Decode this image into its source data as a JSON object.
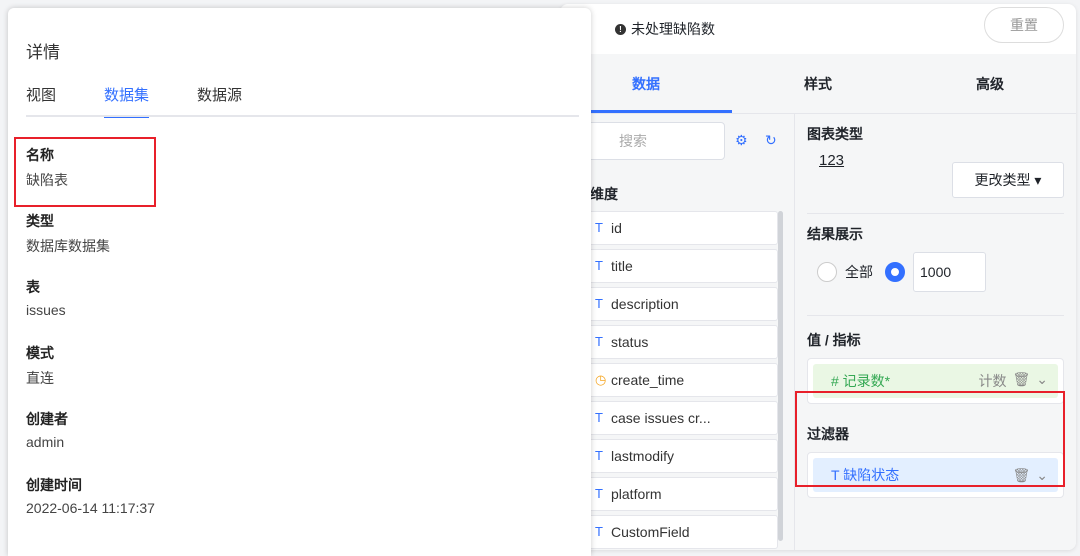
{
  "editor": {
    "chart_title": "未处理缺陷数",
    "reset": "重置",
    "tabs": [
      "数据",
      "样式",
      "高级"
    ],
    "search_placeholder": "搜索",
    "dimension_label": "维度",
    "fields": [
      {
        "type": "T",
        "name": "id"
      },
      {
        "type": "T",
        "name": "title"
      },
      {
        "type": "T",
        "name": "description"
      },
      {
        "type": "T",
        "name": "status"
      },
      {
        "type": "time",
        "name": "create_time"
      },
      {
        "type": "T",
        "name": "case issues cr..."
      },
      {
        "type": "T",
        "name": "lastmodify"
      },
      {
        "type": "T",
        "name": "platform"
      },
      {
        "type": "T",
        "name": "CustomField"
      }
    ],
    "chart_type_label": "图表类型",
    "chart_type_value": "123",
    "change_type": "更改类型 ▾",
    "result_label": "结果展示",
    "radio_all": "全部",
    "result_count": "1000",
    "value_label": "值 / 指标",
    "value_item": "# 记录数*",
    "value_agg": "计数",
    "filter_label": "过滤器",
    "filter_item": "T  缺陷状态"
  },
  "details": {
    "title": "详情",
    "tabs": [
      "视图",
      "数据集",
      "数据源"
    ],
    "props": [
      {
        "k": "名称",
        "v": "缺陷表"
      },
      {
        "k": "类型",
        "v": "数据库数据集"
      },
      {
        "k": "表",
        "v": "issues"
      },
      {
        "k": "模式",
        "v": "直连"
      },
      {
        "k": "创建者",
        "v": "admin"
      },
      {
        "k": "创建时间",
        "v": "2022-06-14 11:17:37"
      }
    ]
  }
}
